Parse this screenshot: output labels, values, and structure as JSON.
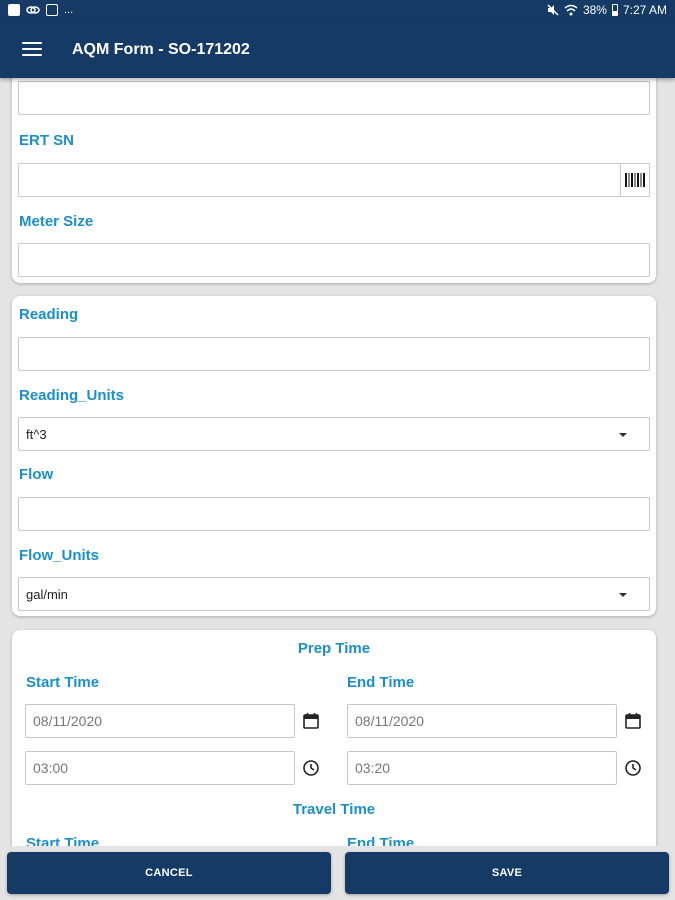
{
  "status_bar": {
    "dots": "...",
    "battery_percent": "38%",
    "time": "7:27 AM"
  },
  "app_bar": {
    "title": "AQM Form - SO-171202"
  },
  "card1": {
    "top_field_value": "",
    "ert_sn_label": "ERT SN",
    "ert_sn_value": "",
    "meter_size_label": "Meter Size",
    "meter_size_value": ""
  },
  "card2": {
    "reading_label": "Reading",
    "reading_value": "",
    "reading_units_label": "Reading_Units",
    "reading_units_value": "ft^3",
    "flow_label": "Flow",
    "flow_value": "",
    "flow_units_label": "Flow_Units",
    "flow_units_value": "gal/min"
  },
  "prep_time": {
    "title": "Prep Time",
    "start_label": "Start Time",
    "end_label": "End Time",
    "start_date": "08/11/2020",
    "start_time": "03:00",
    "end_date": "08/11/2020",
    "end_time": "03:20"
  },
  "travel_time": {
    "title": "Travel Time",
    "start_label": "Start Time",
    "end_label": "End Time"
  },
  "buttons": {
    "cancel": "CANCEL",
    "save": "SAVE"
  },
  "colors": {
    "primary": "#163a66",
    "label": "#1a8fc9",
    "background": "#e4e4e4"
  },
  "icons": [
    "menu-icon",
    "barcode-icon",
    "calendar-icon",
    "clock-icon",
    "dropdown-caret-icon"
  ]
}
